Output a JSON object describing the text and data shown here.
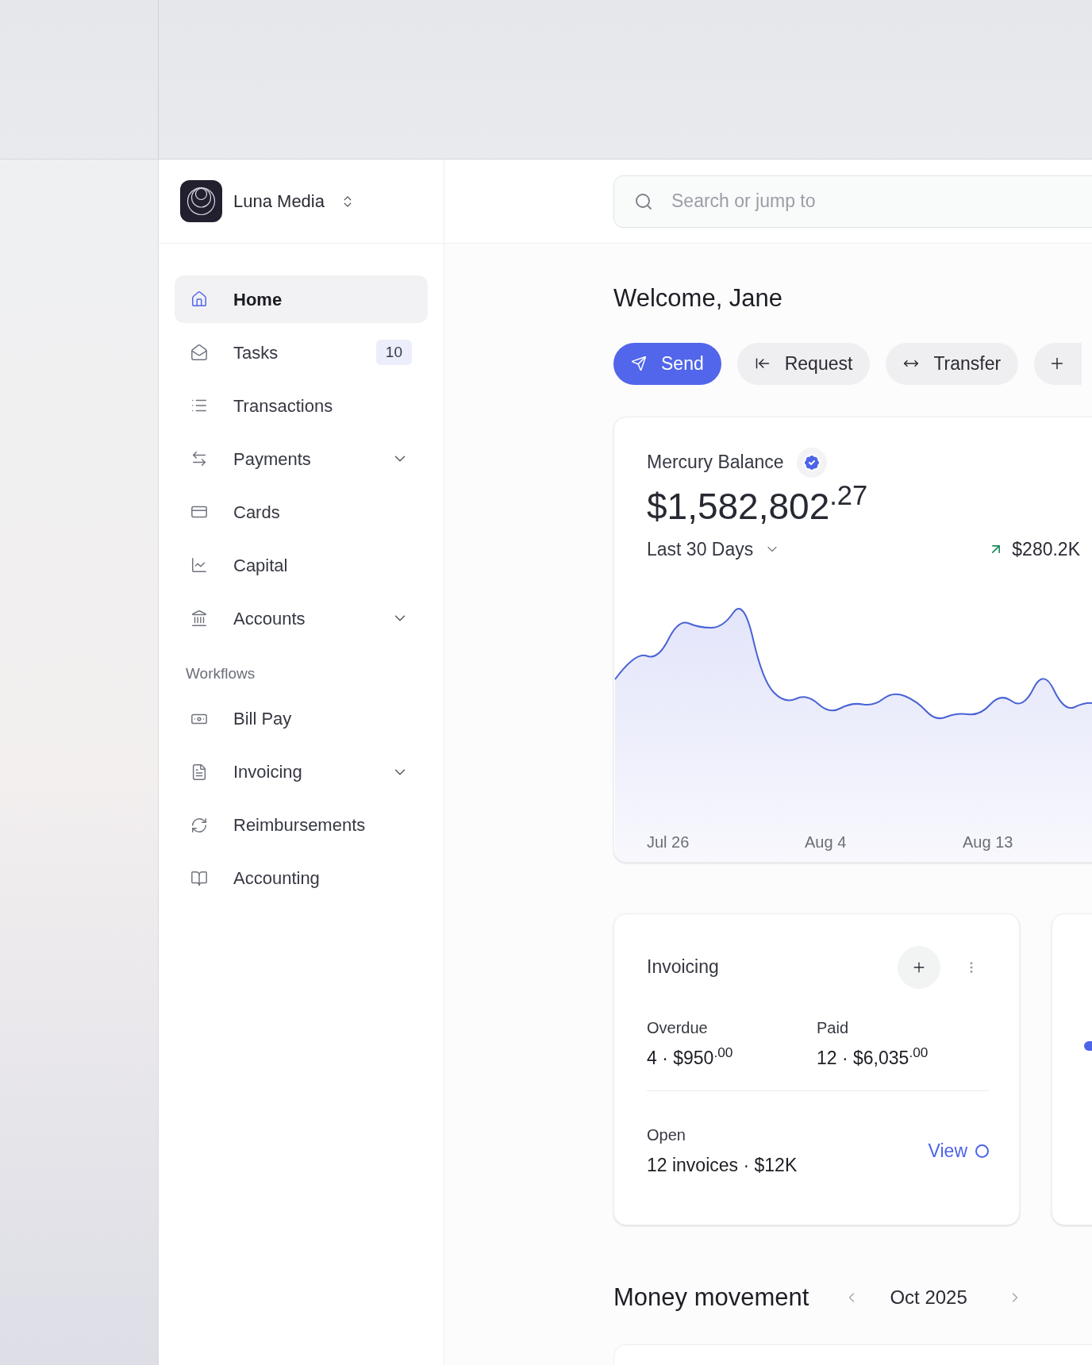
{
  "org": {
    "name": "Luna Media"
  },
  "search": {
    "placeholder": "Search or jump to"
  },
  "sidebar": {
    "items": [
      {
        "label": "Home",
        "selected": true
      },
      {
        "label": "Tasks",
        "selected": false,
        "badge": "10"
      },
      {
        "label": "Transactions",
        "selected": false
      },
      {
        "label": "Payments",
        "selected": false,
        "expanded": false
      },
      {
        "label": "Cards",
        "selected": false
      },
      {
        "label": "Capital",
        "selected": false
      },
      {
        "label": "Accounts",
        "selected": false,
        "expanded": false
      }
    ],
    "section": {
      "title": "Workflows",
      "items": [
        {
          "label": "Bill Pay",
          "selected": false
        },
        {
          "label": "Invoicing",
          "selected": false,
          "expanded": false
        },
        {
          "label": "Reimbursements",
          "selected": false
        },
        {
          "label": "Accounting",
          "selected": false
        }
      ]
    }
  },
  "welcome": "Welcome, Jane",
  "actions": [
    {
      "label": "Send",
      "kind": "primary"
    },
    {
      "label": "Request",
      "kind": "secondary"
    },
    {
      "label": "Transfer",
      "kind": "secondary"
    }
  ],
  "balance": {
    "title": "Mercury Balance",
    "amount": "$1,582,802$^{.27}$",
    "period": "Last 30 Days",
    "change": "$280.2K",
    "x_labels": [
      "Jul 26",
      "Aug 4",
      "Aug 13"
    ]
  },
  "invoicing": {
    "title": "Invoicing",
    "stats": [
      {
        "label": "Overdue",
        "value": "4 · $950$^{.00}$"
      },
      {
        "label": "Paid",
        "value": "12 · $6,035$^{.00}$"
      }
    ],
    "open": {
      "label": "Open",
      "value": "12 invoices · $12K"
    },
    "link": "View"
  },
  "money_movement": {
    "title": "Money movement",
    "month": "Oct 2025"
  }
}
